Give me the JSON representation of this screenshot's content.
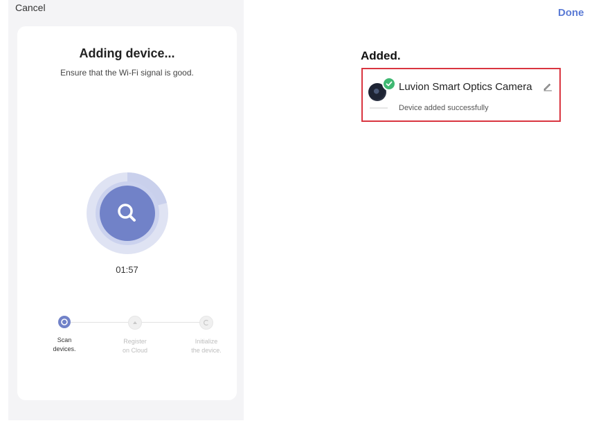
{
  "left": {
    "cancel_label": "Cancel",
    "title": "Adding device...",
    "subtitle": "Ensure that the Wi-Fi signal is good.",
    "timer": "01:57",
    "steps": [
      {
        "line1": "Scan",
        "line2": "devices.",
        "state": "active",
        "icon": "scan-icon"
      },
      {
        "line1": "Register",
        "line2": "on Cloud",
        "state": "pending",
        "icon": "cloud-icon"
      },
      {
        "line1": "Initialize",
        "line2": "the device.",
        "state": "pending",
        "icon": "initialize-icon"
      }
    ]
  },
  "right": {
    "done_label": "Done",
    "section_title": "Added.",
    "device": {
      "name": "Luvion Smart Optics Camera",
      "status": "Device added successfully"
    }
  },
  "colors": {
    "accent": "#7182c8",
    "ring": "#dfe3f3",
    "done": "#5b7bd5",
    "highlight_border": "#d9343f",
    "success": "#3fb872"
  }
}
